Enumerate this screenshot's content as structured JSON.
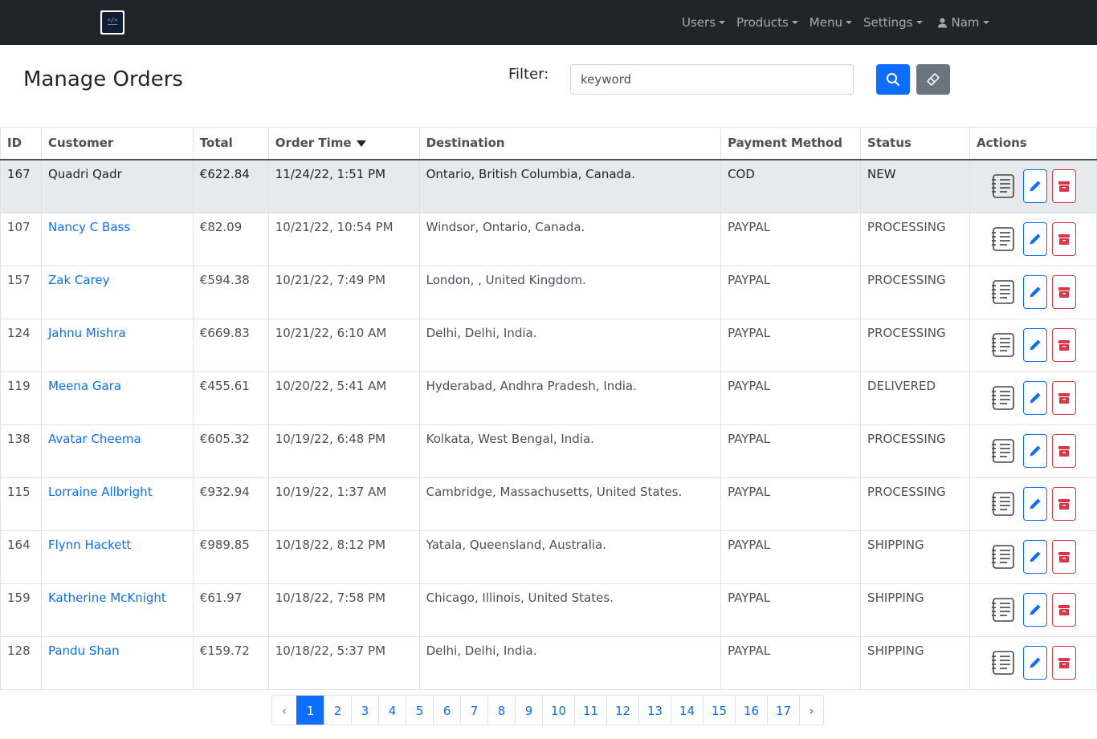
{
  "navbar": {
    "items": [
      {
        "label": "Users"
      },
      {
        "label": "Products"
      },
      {
        "label": "Menu"
      },
      {
        "label": "Settings"
      },
      {
        "label": "Nam"
      }
    ]
  },
  "page": {
    "title": "Manage Orders",
    "filter_label": "Filter:",
    "filter_placeholder": "keyword"
  },
  "table": {
    "headers": [
      "ID",
      "Customer",
      "Total",
      "Order Time",
      "Destination",
      "Payment Method",
      "Status",
      "Actions"
    ],
    "rows": [
      {
        "id": "167",
        "customer": "Quadri Qadr",
        "total": "€622.84",
        "time": "11/24/22, 1:51 PM",
        "destination": "Ontario, British Columbia, Canada.",
        "payment": "COD",
        "status": "NEW"
      },
      {
        "id": "107",
        "customer": "Nancy C Bass",
        "total": "€82.09",
        "time": "10/21/22, 10:54 PM",
        "destination": "Windsor, Ontario, Canada.",
        "payment": "PAYPAL",
        "status": "PROCESSING"
      },
      {
        "id": "157",
        "customer": "Zak Carey",
        "total": "€594.38",
        "time": "10/21/22, 7:49 PM",
        "destination": "London, , United Kingdom.",
        "payment": "PAYPAL",
        "status": "PROCESSING"
      },
      {
        "id": "124",
        "customer": "Jahnu Mishra",
        "total": "€669.83",
        "time": "10/21/22, 6:10 AM",
        "destination": "Delhi, Delhi, India.",
        "payment": "PAYPAL",
        "status": "PROCESSING"
      },
      {
        "id": "119",
        "customer": "Meena Gara",
        "total": "€455.61",
        "time": "10/20/22, 5:41 AM",
        "destination": "Hyderabad, Andhra Pradesh, India.",
        "payment": "PAYPAL",
        "status": "DELIVERED"
      },
      {
        "id": "138",
        "customer": "Avatar Cheema",
        "total": "€605.32",
        "time": "10/19/22, 6:48 PM",
        "destination": "Kolkata, West Bengal, India.",
        "payment": "PAYPAL",
        "status": "PROCESSING"
      },
      {
        "id": "115",
        "customer": "Lorraine Allbright",
        "total": "€932.94",
        "time": "10/19/22, 1:37 AM",
        "destination": "Cambridge, Massachusetts, United States.",
        "payment": "PAYPAL",
        "status": "PROCESSING"
      },
      {
        "id": "164",
        "customer": "Flynn Hackett",
        "total": "€989.85",
        "time": "10/18/22, 8:12 PM",
        "destination": "Yatala, Queensland, Australia.",
        "payment": "PAYPAL",
        "status": "SHIPPING"
      },
      {
        "id": "159",
        "customer": "Katherine McKnight",
        "total": "€61.97",
        "time": "10/18/22, 7:58 PM",
        "destination": "Chicago, Illinois, United States.",
        "payment": "PAYPAL",
        "status": "SHIPPING"
      },
      {
        "id": "128",
        "customer": "Pandu Shan",
        "total": "€159.72",
        "time": "10/18/22, 5:37 PM",
        "destination": "Delhi, Delhi, India.",
        "payment": "PAYPAL",
        "status": "SHIPPING"
      }
    ]
  },
  "pagination": {
    "prev": "‹",
    "next": "›",
    "pages": [
      "1",
      "2",
      "3",
      "4",
      "5",
      "6",
      "7",
      "8",
      "9",
      "10",
      "11",
      "12",
      "13",
      "14",
      "15",
      "16",
      "17"
    ],
    "current": "1"
  },
  "colors": {
    "navbar": "#212529",
    "primary": "#0d6efd",
    "danger": "#dc3545",
    "secondary": "#6c757d"
  }
}
